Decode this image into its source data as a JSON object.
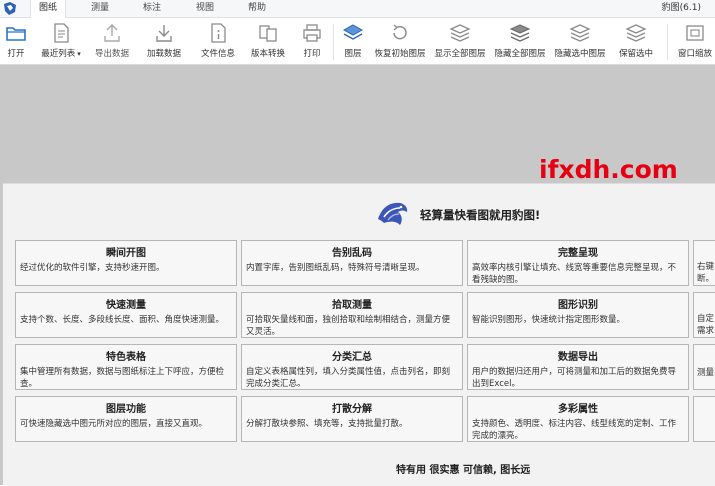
{
  "tabs": [
    {
      "label": "图纸",
      "active": true
    },
    {
      "label": "测量",
      "active": false
    },
    {
      "label": "标注",
      "active": false
    },
    {
      "label": "视图",
      "active": false
    },
    {
      "label": "帮助",
      "active": false
    }
  ],
  "window_title": "豹图(6.1)",
  "ribbon": {
    "open": "打开",
    "recent": "最近列表",
    "recent_arrow": "▾",
    "export": "导出数据",
    "load": "加载数据",
    "file_info": "文件信息",
    "version_convert": "版本转换",
    "print": "打印",
    "layers": "图层",
    "restore_layers": "恢复初始图层",
    "show_all_layers": "显示全部图层",
    "hide_all_layers": "隐藏全部图层",
    "hide_selected_layers": "隐藏选中图层",
    "keep_selected": "保留选中",
    "window_zoom": "窗口缩放"
  },
  "watermark": "ifxdh.com",
  "slogan": "轻算量快看图就用豹图!",
  "cards": [
    {
      "title": "瞬间开图",
      "desc": "经过优化的软件引擎，支持秒速开图。"
    },
    {
      "title": "告别乱码",
      "desc": "内置字库，告别图纸乱码，特殊符号清晰呈现。"
    },
    {
      "title": "完整呈现",
      "desc": "高效率内核引擎让填充、线宽等重要信息完整呈现，不看残缺的图。"
    },
    {
      "title": "",
      "desc": "右键断。"
    },
    {
      "title": "快速测量",
      "desc": "支持个数、长度、多段线长度、面积、角度快速测量。"
    },
    {
      "title": "拾取测量",
      "desc": "可拾取矢量线和面，独创拾取和绘制相结合，测量方便又灵活。"
    },
    {
      "title": "图形识别",
      "desc": "智能识别图形，快速统计指定图形数量。"
    },
    {
      "title": "",
      "desc": "自定需求"
    },
    {
      "title": "特色表格",
      "desc": "集中管理所有数据，数据与图纸标注上下呼应，方便检查。"
    },
    {
      "title": "分类汇总",
      "desc": "自定义表格属性列，填入分类属性值，点击列名，即刻完成分类汇总。"
    },
    {
      "title": "数据导出",
      "desc": "用户的数据归还用户，可将测量和加工后的数据免费导出到Excel。"
    },
    {
      "title": "",
      "desc": "测量"
    },
    {
      "title": "图层功能",
      "desc": "可快速隐藏选中图元所对应的图层，直接又直观。"
    },
    {
      "title": "打散分解",
      "desc": "分解打散块参照、填充等，支持批量打散。"
    },
    {
      "title": "多彩属性",
      "desc": "支持颜色、透明度、标注内容、线型线宽的定制、工作完成的漂亮。"
    },
    {
      "title": "",
      "desc": ""
    }
  ],
  "footer": "特有用 很实惠 可信赖, 图长远",
  "colors": {
    "accent_blue": "#2b5fb3",
    "watermark_red": "#e60012",
    "canvas_gray": "#c8c8c8",
    "panel_bg": "#f2f2f2"
  }
}
